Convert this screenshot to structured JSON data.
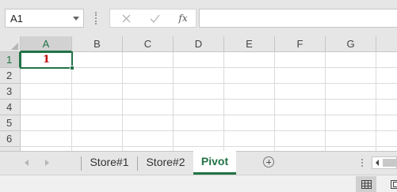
{
  "formula_bar": {
    "name_box_value": "A1",
    "cancel_symbol": "✕",
    "enter_symbol": "✓",
    "function_symbol": "fx",
    "formula_value": ""
  },
  "grid": {
    "column_headers": [
      "A",
      "B",
      "C",
      "D",
      "E",
      "F",
      "G"
    ],
    "row_headers": [
      "1",
      "2",
      "3",
      "4",
      "5",
      "6"
    ],
    "active_cell": {
      "ref": "A1",
      "value": "1",
      "color": "#c00000"
    }
  },
  "sheet_tabs": {
    "tabs": [
      "Store#1",
      "Store#2",
      "Pivot"
    ],
    "active_tab": "Pivot",
    "accent_color": "#217346"
  },
  "status_bar": {
    "views": [
      "normal-view",
      "page-layout-view"
    ],
    "active_view": "normal-view"
  }
}
